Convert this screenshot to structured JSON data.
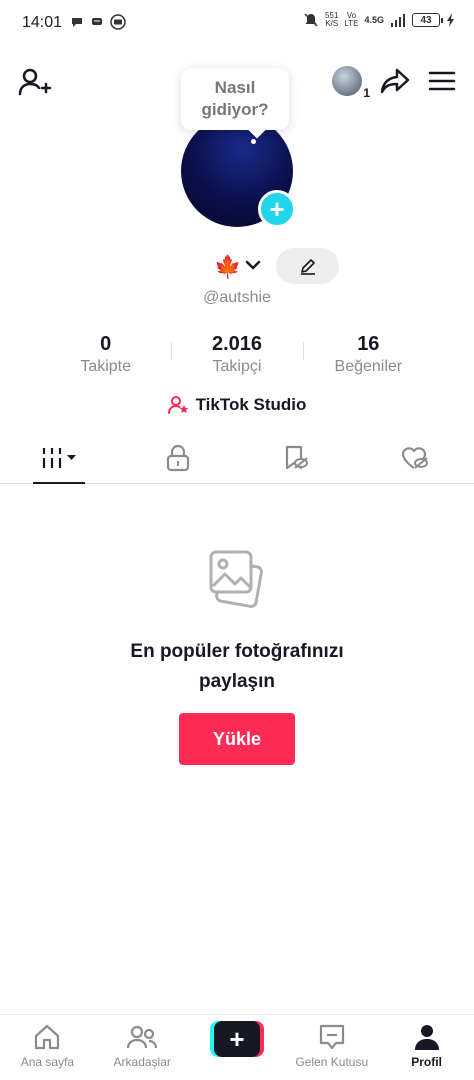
{
  "status_bar": {
    "time": "14:01",
    "speed_value": "551",
    "speed_unit": "K/S",
    "volte_top": "Vo",
    "volte_bottom": "LTE",
    "network": "4.5G",
    "battery": "43"
  },
  "bubble": {
    "line1": "Nasıl",
    "line2": "gidiyor?"
  },
  "mini_avatar_count": "1",
  "username": "@autshie",
  "stats": [
    {
      "value": "0",
      "label": "Takipte"
    },
    {
      "value": "2.016",
      "label": "Takipçi"
    },
    {
      "value": "16",
      "label": "Beğeniler"
    }
  ],
  "studio_label": "TikTok Studio",
  "empty_state": {
    "title": "En popüler fotoğrafınızı paylaşın",
    "button": "Yükle"
  },
  "nav": {
    "home": "Ana sayfa",
    "friends": "Arkadaşlar",
    "inbox": "Gelen Kutusu",
    "profile": "Profil"
  },
  "colors": {
    "accent": "#fe2c55",
    "cyan": "#20d5ec",
    "text": "#161823",
    "muted": "#8a8b91"
  }
}
